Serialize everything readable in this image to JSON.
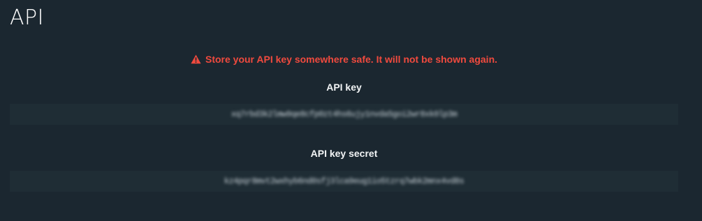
{
  "page": {
    "title": "API",
    "background_color": "#1b2730"
  },
  "warning": {
    "icon": "warning-triangle-icon",
    "text": "Store your API key somewhere safe. It will not be shown again.",
    "color": "#f04a3e"
  },
  "api_key": {
    "label": "API key",
    "value": "xq7rbd3k2lmw9qe8cfp0zt4hs6ujy1nvda5goi2wr8xk0lp3m"
  },
  "api_key_secret": {
    "label": "API key secret",
    "value": "kz4pqr8mvt2wxhyb6nd0sfj3lca9eug1io5tzrq7wbk2mnx4vd8s"
  }
}
